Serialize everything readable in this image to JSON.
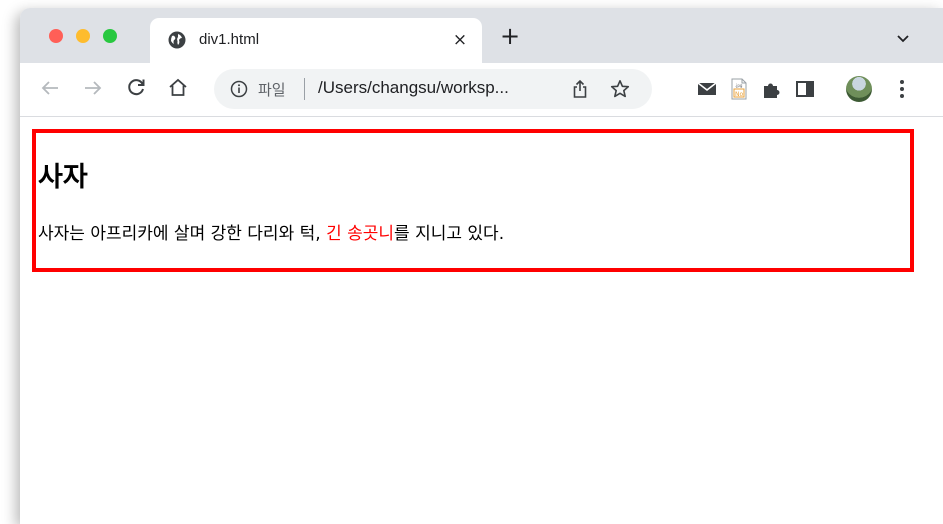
{
  "window": {
    "traffic_lights": [
      "close",
      "minimize",
      "maximize"
    ]
  },
  "tab": {
    "title": "div1.html",
    "icon": "globe-icon",
    "close": "×"
  },
  "tabstrip": {
    "new_tab": "+",
    "menu_icon": "chevron-down-icon"
  },
  "toolbar": {
    "back_icon": "arrow-left-icon",
    "forward_icon": "arrow-right-icon",
    "reload_icon": "reload-icon",
    "home_icon": "home-icon"
  },
  "omnibox": {
    "info_icon": "info-icon",
    "scheme_label": "파일",
    "url": "/Users/changsu/worksp...",
    "share_icon": "share-icon",
    "bookmark_icon": "star-icon"
  },
  "extensions": [
    "mail-icon",
    "jpg-file-icon",
    "puzzle-icon",
    "side-panel-icon",
    "avatar",
    "kebab-menu-icon"
  ],
  "colors": {
    "box_border": "#ff0000",
    "highlight": "#ff0000",
    "tabstrip_bg": "#dee1e6",
    "omnibox_bg": "#f1f3f4"
  },
  "page": {
    "heading": "사자",
    "paragraph": {
      "before": "사자는 아프리카에 살며 강한 다리와 턱, ",
      "highlight": "긴 송곳니",
      "after": "를 지니고 있다."
    }
  }
}
